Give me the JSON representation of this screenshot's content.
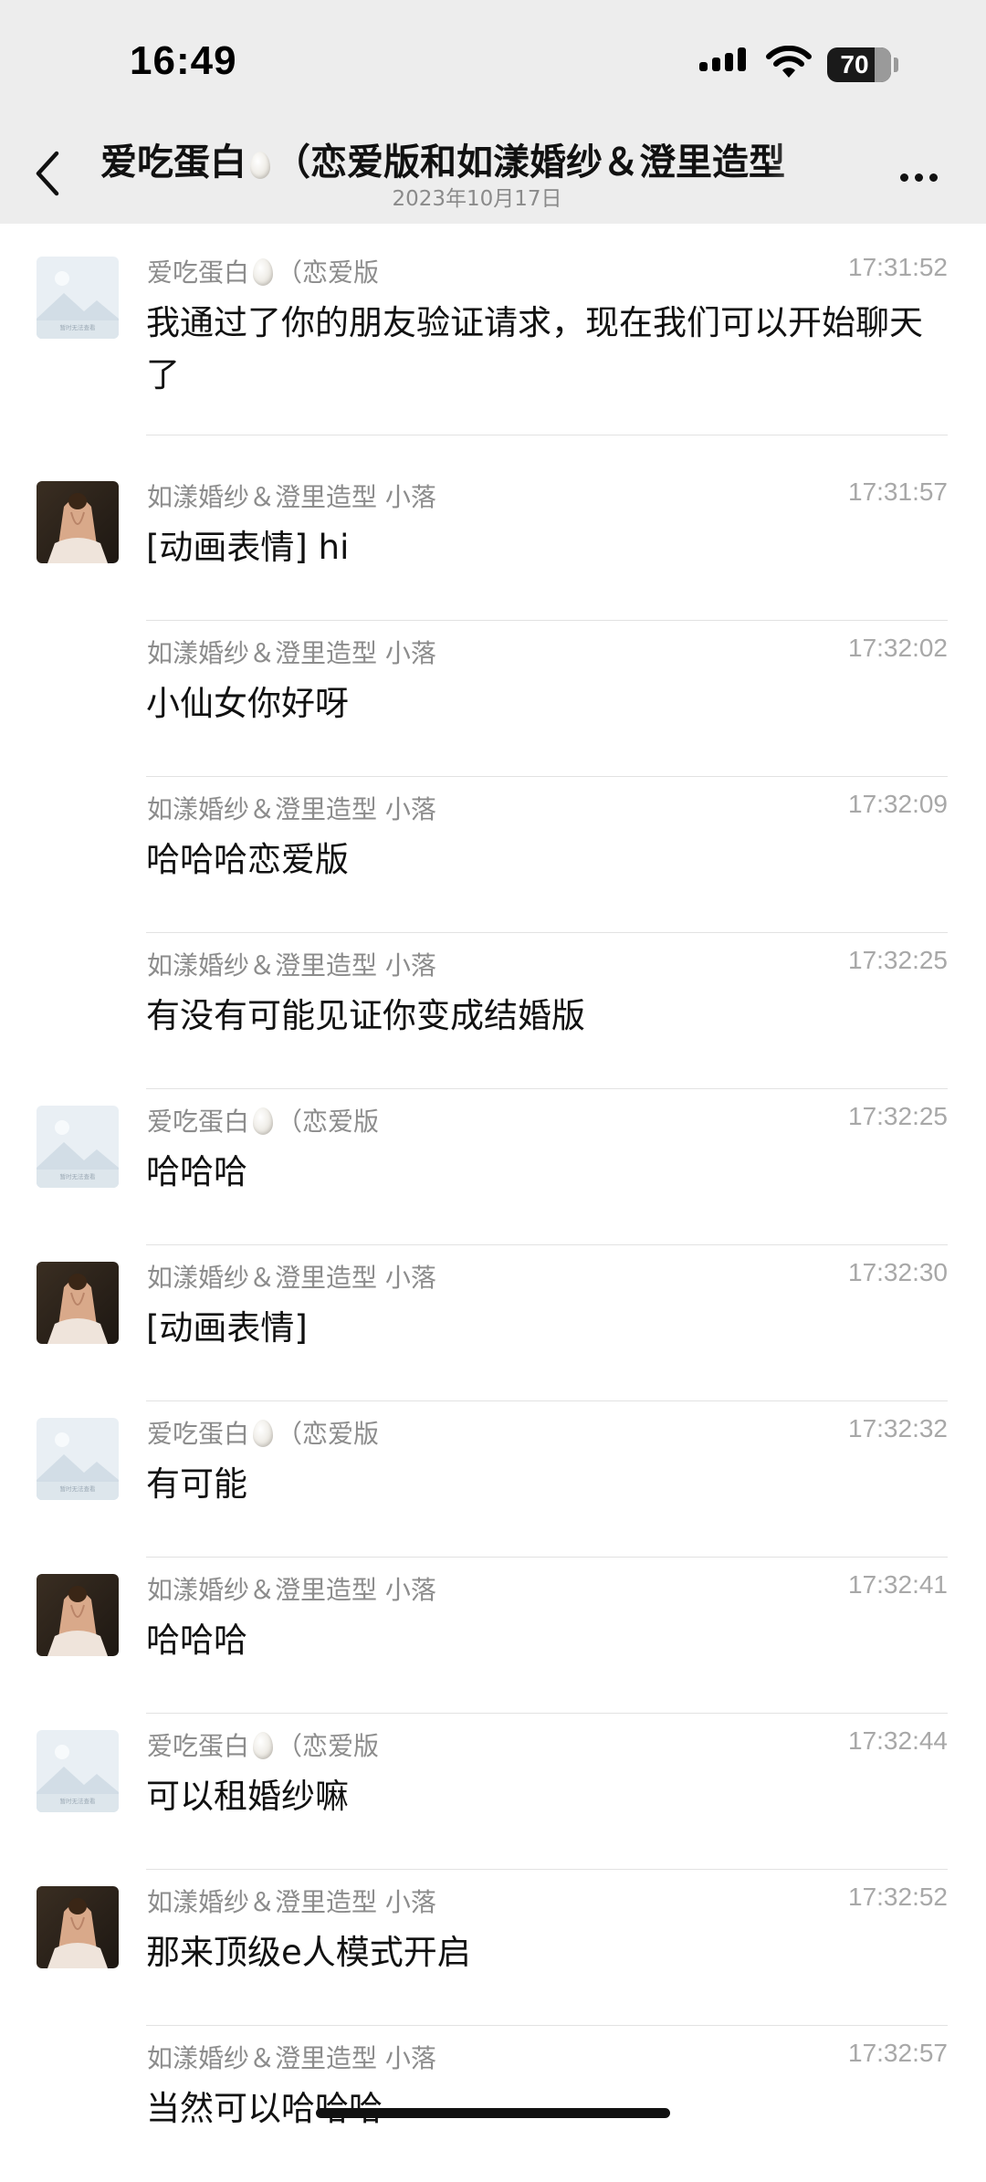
{
  "status_bar": {
    "time": "16:49",
    "battery": "70"
  },
  "nav": {
    "title": "爱吃蛋白🥚（恋爱版和如漾婚纱＆澄里造型",
    "date": "2023年10月17日"
  },
  "avatars": {
    "placeholder_text": "暂时无法查看"
  },
  "messages": [
    {
      "sender": "爱吃蛋白🥚（恋爱版",
      "time": "17:31:52",
      "text": "我通过了你的朋友验证请求，现在我们可以开始聊天了",
      "avatar": "placeholder"
    },
    {
      "sender": "如漾婚纱＆澄里造型 小落",
      "time": "17:31:57",
      "text": "[动画表情] hi",
      "avatar": "photo"
    },
    {
      "sender": "如漾婚纱＆澄里造型 小落",
      "time": "17:32:02",
      "text": "小仙女你好呀",
      "avatar": "none"
    },
    {
      "sender": "如漾婚纱＆澄里造型 小落",
      "time": "17:32:09",
      "text": "哈哈哈恋爱版",
      "avatar": "none"
    },
    {
      "sender": "如漾婚纱＆澄里造型 小落",
      "time": "17:32:25",
      "text": "有没有可能见证你变成结婚版",
      "avatar": "none"
    },
    {
      "sender": "爱吃蛋白🥚（恋爱版",
      "time": "17:32:25",
      "text": "哈哈哈",
      "avatar": "placeholder"
    },
    {
      "sender": "如漾婚纱＆澄里造型 小落",
      "time": "17:32:30",
      "text": "[动画表情]",
      "avatar": "photo"
    },
    {
      "sender": "爱吃蛋白🥚（恋爱版",
      "time": "17:32:32",
      "text": "有可能",
      "avatar": "placeholder"
    },
    {
      "sender": "如漾婚纱＆澄里造型 小落",
      "time": "17:32:41",
      "text": "哈哈哈",
      "avatar": "photo"
    },
    {
      "sender": "爱吃蛋白🥚（恋爱版",
      "time": "17:32:44",
      "text": "可以租婚纱嘛",
      "avatar": "placeholder"
    },
    {
      "sender": "如漾婚纱＆澄里造型 小落",
      "time": "17:32:52",
      "text": "那来顶级e人模式开启",
      "avatar": "photo"
    },
    {
      "sender": "如漾婚纱＆澄里造型 小落",
      "time": "17:32:57",
      "text": "当然可以哈哈哈",
      "avatar": "none"
    }
  ]
}
